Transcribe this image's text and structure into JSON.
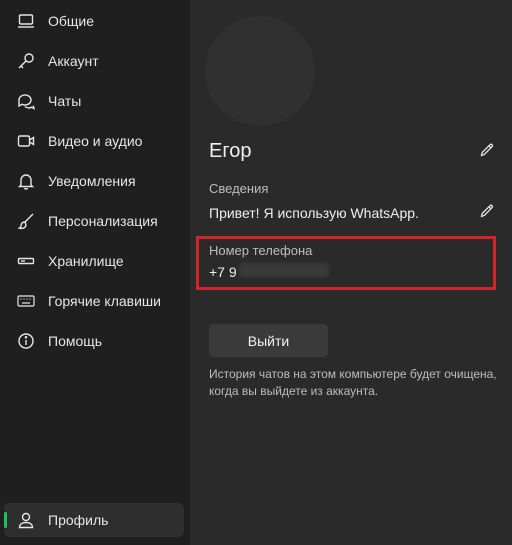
{
  "sidebar": {
    "items": [
      {
        "label": "Общие",
        "icon": "laptop-icon"
      },
      {
        "label": "Аккаунт",
        "icon": "key-icon"
      },
      {
        "label": "Чаты",
        "icon": "chat-icon"
      },
      {
        "label": "Видео и аудио",
        "icon": "video-icon"
      },
      {
        "label": "Уведомления",
        "icon": "bell-icon"
      },
      {
        "label": "Персонализация",
        "icon": "brush-icon"
      },
      {
        "label": "Хранилище",
        "icon": "storage-icon"
      },
      {
        "label": "Горячие клавиши",
        "icon": "keyboard-icon"
      },
      {
        "label": "Помощь",
        "icon": "info-icon"
      }
    ],
    "profile": {
      "label": "Профиль",
      "icon": "person-icon",
      "active": true
    }
  },
  "profile": {
    "name": "Егор",
    "about_label": "Сведения",
    "about_value": "Привет! Я использую WhatsApp.",
    "phone_label": "Номер телефона",
    "phone_value": "+7 9",
    "logout_label": "Выйти",
    "logout_note": "История чатов на этом компьютере будет очищена, когда вы выйдете из аккаунта."
  },
  "colors": {
    "accent": "#21c063",
    "highlight_border": "#d1242b",
    "sidebar_bg": "#1f1f1f",
    "main_bg": "#2a2a2a"
  }
}
